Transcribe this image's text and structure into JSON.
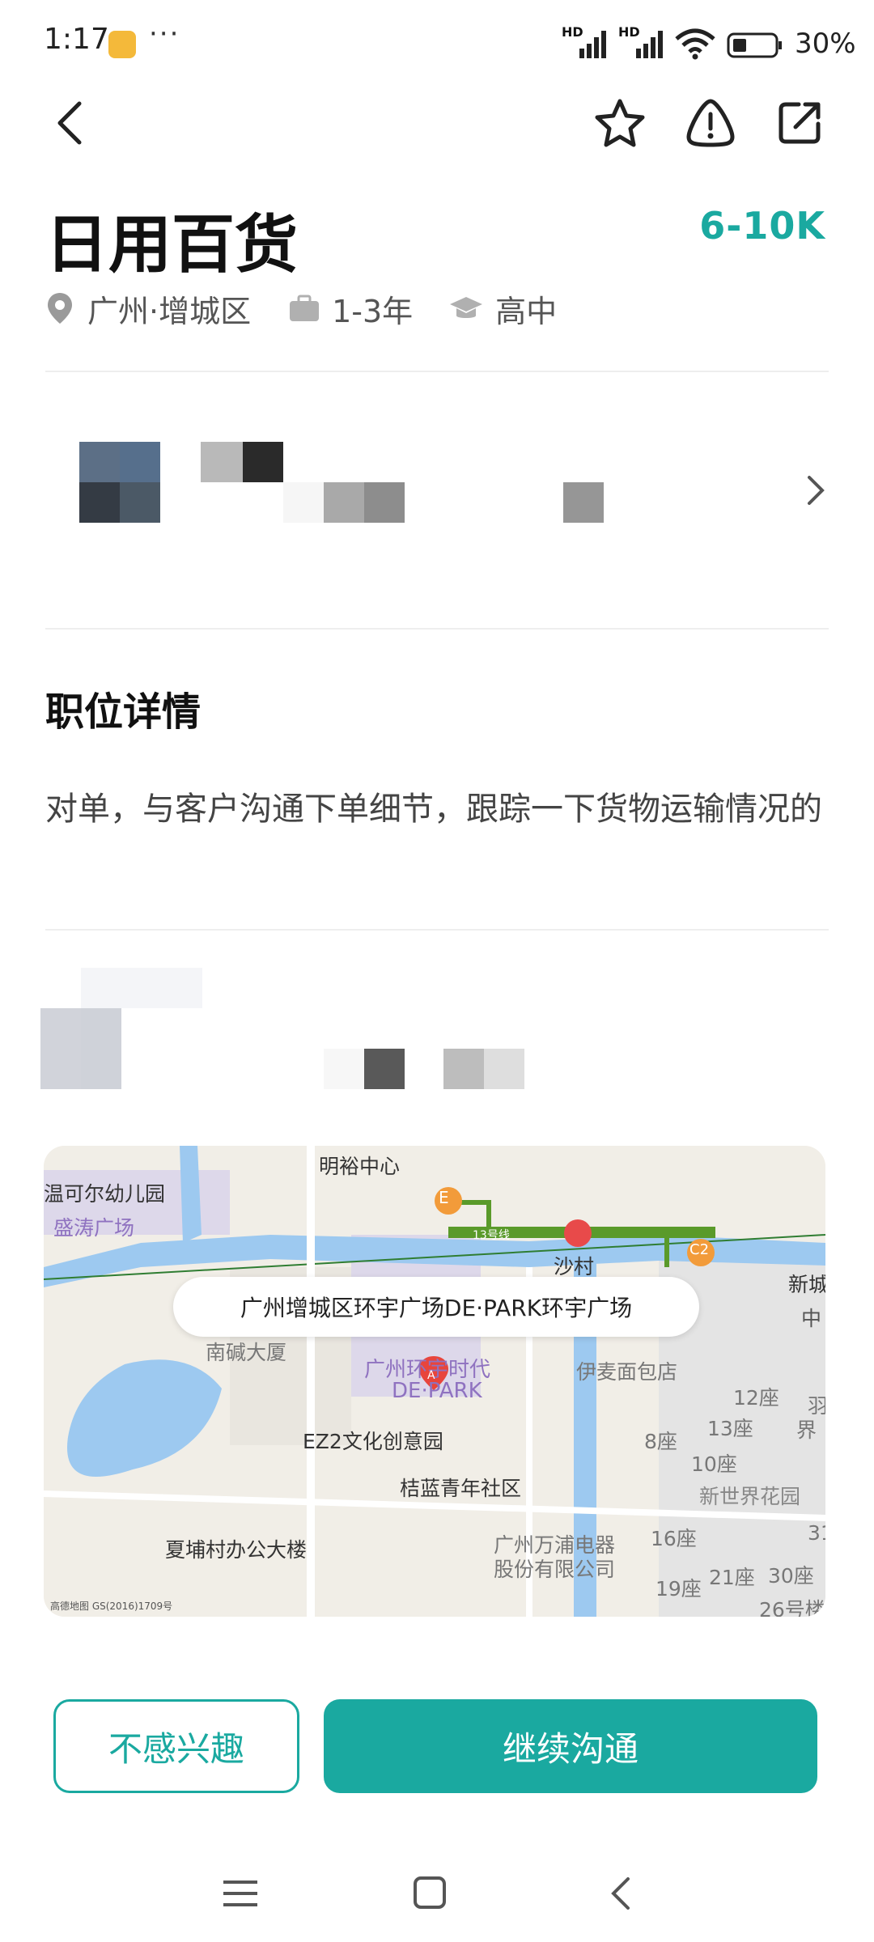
{
  "status_bar": {
    "time": "1:17",
    "more": "···",
    "signal1": "HD",
    "signal2": "HD",
    "battery": "30%"
  },
  "job": {
    "title": "日用百货",
    "salary": "6-10K",
    "location": "广州·增城区",
    "experience": "1-3年",
    "education": "高中"
  },
  "detail": {
    "heading": "职位详情",
    "description": "对单，与客户沟通下单细节，跟踪一下货物运输情况的"
  },
  "map": {
    "address": "广州增城区环宇广场DE·PARK环宇广场",
    "labels": {
      "mingyu": "明裕中心",
      "kindergarten": "温可尔幼儿园",
      "shengtao": "盛涛广场",
      "shacun": "沙村",
      "nancheng": "南碱大厦",
      "huanyu": "广州环宇时代",
      "depark": "DE·PARK",
      "yimai": "伊麦面包店",
      "ez2": "EZ2文化创意园",
      "jielan": "桔蓝青年社区",
      "xiabu": "夏埔村办公大楼",
      "wanpu": "广州万浦电器",
      "wanpu2": "股份有限公司",
      "newworld": "新世界花园",
      "b12": "12座",
      "b13": "13座",
      "b8": "8座",
      "b10": "10座",
      "b16": "16座",
      "b19": "19座",
      "b21": "21座",
      "b30": "30座",
      "b26": "26号楼",
      "line13": "13号线",
      "stationE": "E",
      "stationC2": "C2",
      "markerA": "A",
      "copyright": "高德地图 GS(2016)1709号",
      "xin": "新城",
      "zhong": "中",
      "yu": "羽",
      "jie": "界",
      "b31": "31"
    }
  },
  "actions": {
    "not_interested": "不感兴趣",
    "continue_chat": "继续沟通"
  },
  "colors": {
    "accent": "#1aa9a0",
    "salary": "#1aa9a0"
  },
  "icons": {
    "back": "back-icon",
    "favorite": "star-icon",
    "report": "warning-icon",
    "share": "share-icon",
    "location": "location-pin-icon",
    "experience": "briefcase-icon",
    "education": "graduation-cap-icon",
    "chevron": "chevron-right-icon"
  }
}
